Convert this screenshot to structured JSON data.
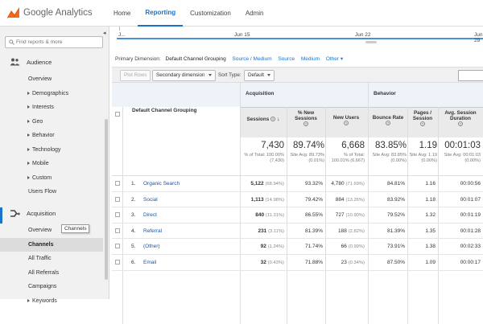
{
  "header": {
    "logo_text": "Google Analytics",
    "nav": [
      {
        "label": "Home",
        "active": false
      },
      {
        "label": "Reporting",
        "active": true
      },
      {
        "label": "Customization",
        "active": false
      },
      {
        "label": "Admin",
        "active": false
      }
    ]
  },
  "sidebar": {
    "search_placeholder": "Find reports & more",
    "audience": {
      "label": "Audience",
      "items": [
        {
          "label": "Overview",
          "arrow": false
        },
        {
          "label": "Demographics",
          "arrow": true
        },
        {
          "label": "Interests",
          "arrow": true
        },
        {
          "label": "Geo",
          "arrow": true
        },
        {
          "label": "Behavior",
          "arrow": true
        },
        {
          "label": "Technology",
          "arrow": true
        },
        {
          "label": "Mobile",
          "arrow": true
        },
        {
          "label": "Custom",
          "arrow": true
        },
        {
          "label": "Users Flow",
          "arrow": false
        }
      ]
    },
    "acquisition": {
      "label": "Acquisition",
      "items": [
        {
          "label": "Overview"
        },
        {
          "label": "Channels"
        },
        {
          "label": "All Traffic"
        },
        {
          "label": "All Referrals"
        },
        {
          "label": "Campaigns"
        },
        {
          "label": "Keywords"
        }
      ]
    },
    "tooltip": "Channels",
    "accent_color": "#1a73c9"
  },
  "timeline": {
    "labels": [
      "J...",
      "Jun 15",
      "Jun 22",
      "Jun 29"
    ]
  },
  "primary_dimension": {
    "label": "Primary Dimension:",
    "selected": "Default Channel Grouping",
    "options": [
      "Source / Medium",
      "Source",
      "Medium",
      "Other"
    ]
  },
  "toolbar": {
    "plot_rows": "Plot Rows",
    "secondary_dimension": "Secondary dimension",
    "sort_type_label": "Sort Type:",
    "sort_type_value": "Default"
  },
  "table": {
    "dimension_header": "Default Channel Grouping",
    "group_acquisition": "Acquisition",
    "group_behavior": "Behavior",
    "columns": {
      "sessions": "Sessions",
      "new_sessions": "% New Sessions",
      "new_users": "New Users",
      "bounce_rate": "Bounce Rate",
      "pages_session": "Pages / Session",
      "avg_duration": "Avg. Session Duration"
    },
    "totals": {
      "sessions": "7,430",
      "sessions_sub": "% of Total: 100.00% (7,430)",
      "new_sessions": "89.74%",
      "new_sessions_sub": "Site Avg: 89.73% (0.01%)",
      "new_users": "6,668",
      "new_users_sub": "% of Total: 100.01% (6,667)",
      "bounce_rate": "83.85%",
      "bounce_rate_sub": "Site Avg: 83.85% (0.00%)",
      "pages_session": "1.19",
      "pages_session_sub": "Site Avg: 1.19 (0.00%)",
      "avg_duration": "00:01:03",
      "avg_duration_sub": "Site Avg: 00:01:03 (0.00%)"
    },
    "rows": [
      {
        "idx": "1.",
        "name": "Organic Search",
        "sessions": "5,122",
        "sessions_pct": "(68.94%)",
        "new_sessions": "93.32%",
        "new_users": "4,780",
        "new_users_pct": "(71.69%)",
        "bounce": "84.81%",
        "pages": "1.16",
        "duration": "00:00:56"
      },
      {
        "idx": "2.",
        "name": "Social",
        "sessions": "1,113",
        "sessions_pct": "(14.98%)",
        "new_sessions": "79.42%",
        "new_users": "884",
        "new_users_pct": "(13.26%)",
        "bounce": "83.92%",
        "pages": "1.18",
        "duration": "00:01:07"
      },
      {
        "idx": "3.",
        "name": "Direct",
        "sessions": "840",
        "sessions_pct": "(11.31%)",
        "new_sessions": "86.55%",
        "new_users": "727",
        "new_users_pct": "(10.90%)",
        "bounce": "79.52%",
        "pages": "1.32",
        "duration": "00:01:19"
      },
      {
        "idx": "4.",
        "name": "Referral",
        "sessions": "231",
        "sessions_pct": "(3.11%)",
        "new_sessions": "81.39%",
        "new_users": "188",
        "new_users_pct": "(2.82%)",
        "bounce": "81.39%",
        "pages": "1.35",
        "duration": "00:01:28"
      },
      {
        "idx": "5.",
        "name": "(Other)",
        "sessions": "92",
        "sessions_pct": "(1.24%)",
        "new_sessions": "71.74%",
        "new_users": "66",
        "new_users_pct": "(0.99%)",
        "bounce": "73.91%",
        "pages": "1.38",
        "duration": "00:02:33"
      },
      {
        "idx": "6.",
        "name": "Email",
        "sessions": "32",
        "sessions_pct": "(0.43%)",
        "new_sessions": "71.88%",
        "new_users": "23",
        "new_users_pct": "(0.34%)",
        "bounce": "87.50%",
        "pages": "1.09",
        "duration": "00:00:17"
      }
    ]
  }
}
